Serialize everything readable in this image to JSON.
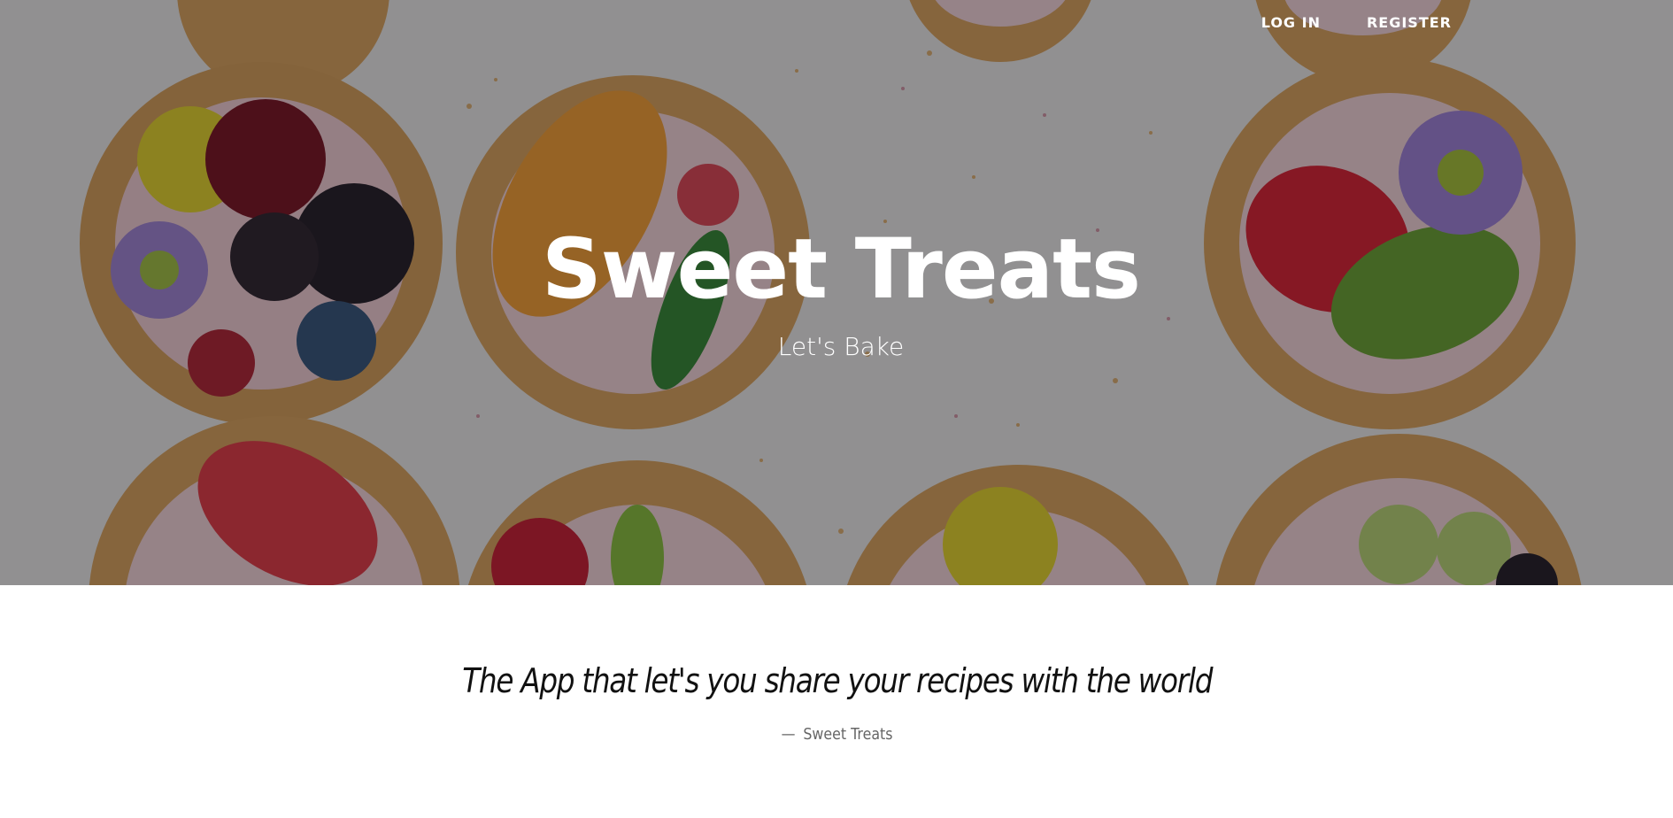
{
  "nav": {
    "login_label": "LOG IN",
    "register_label": "REGISTER"
  },
  "hero": {
    "title": "Sweet Treats",
    "subtitle": "Let's Bake",
    "background_image": "pastries-with-fruit-and-flowers"
  },
  "quote": {
    "text": "The App that let's you share your recipes with the world",
    "dash": "—",
    "attribution": "Sweet Treats"
  },
  "colors": {
    "hero_text": "#ffffff",
    "overlay": "rgba(0,0,0,0.38)",
    "quote_text": "#111111",
    "attribution_text": "#666666",
    "page_background": "#ffffff"
  }
}
